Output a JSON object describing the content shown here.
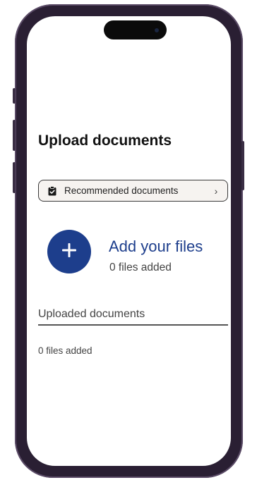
{
  "page": {
    "title": "Upload documents"
  },
  "recommended": {
    "label": "Recommended documents",
    "icon": "clipboard-check-icon",
    "chevron": "›"
  },
  "add_files": {
    "icon": "plus-icon",
    "title": "Add your files",
    "count_text": "0 files added"
  },
  "uploaded": {
    "heading": "Uploaded documents",
    "count_text": "0 files added"
  },
  "colors": {
    "accent": "#1d3e8c",
    "frame": "#2a1f33",
    "button_bg": "#f6f3f0"
  }
}
